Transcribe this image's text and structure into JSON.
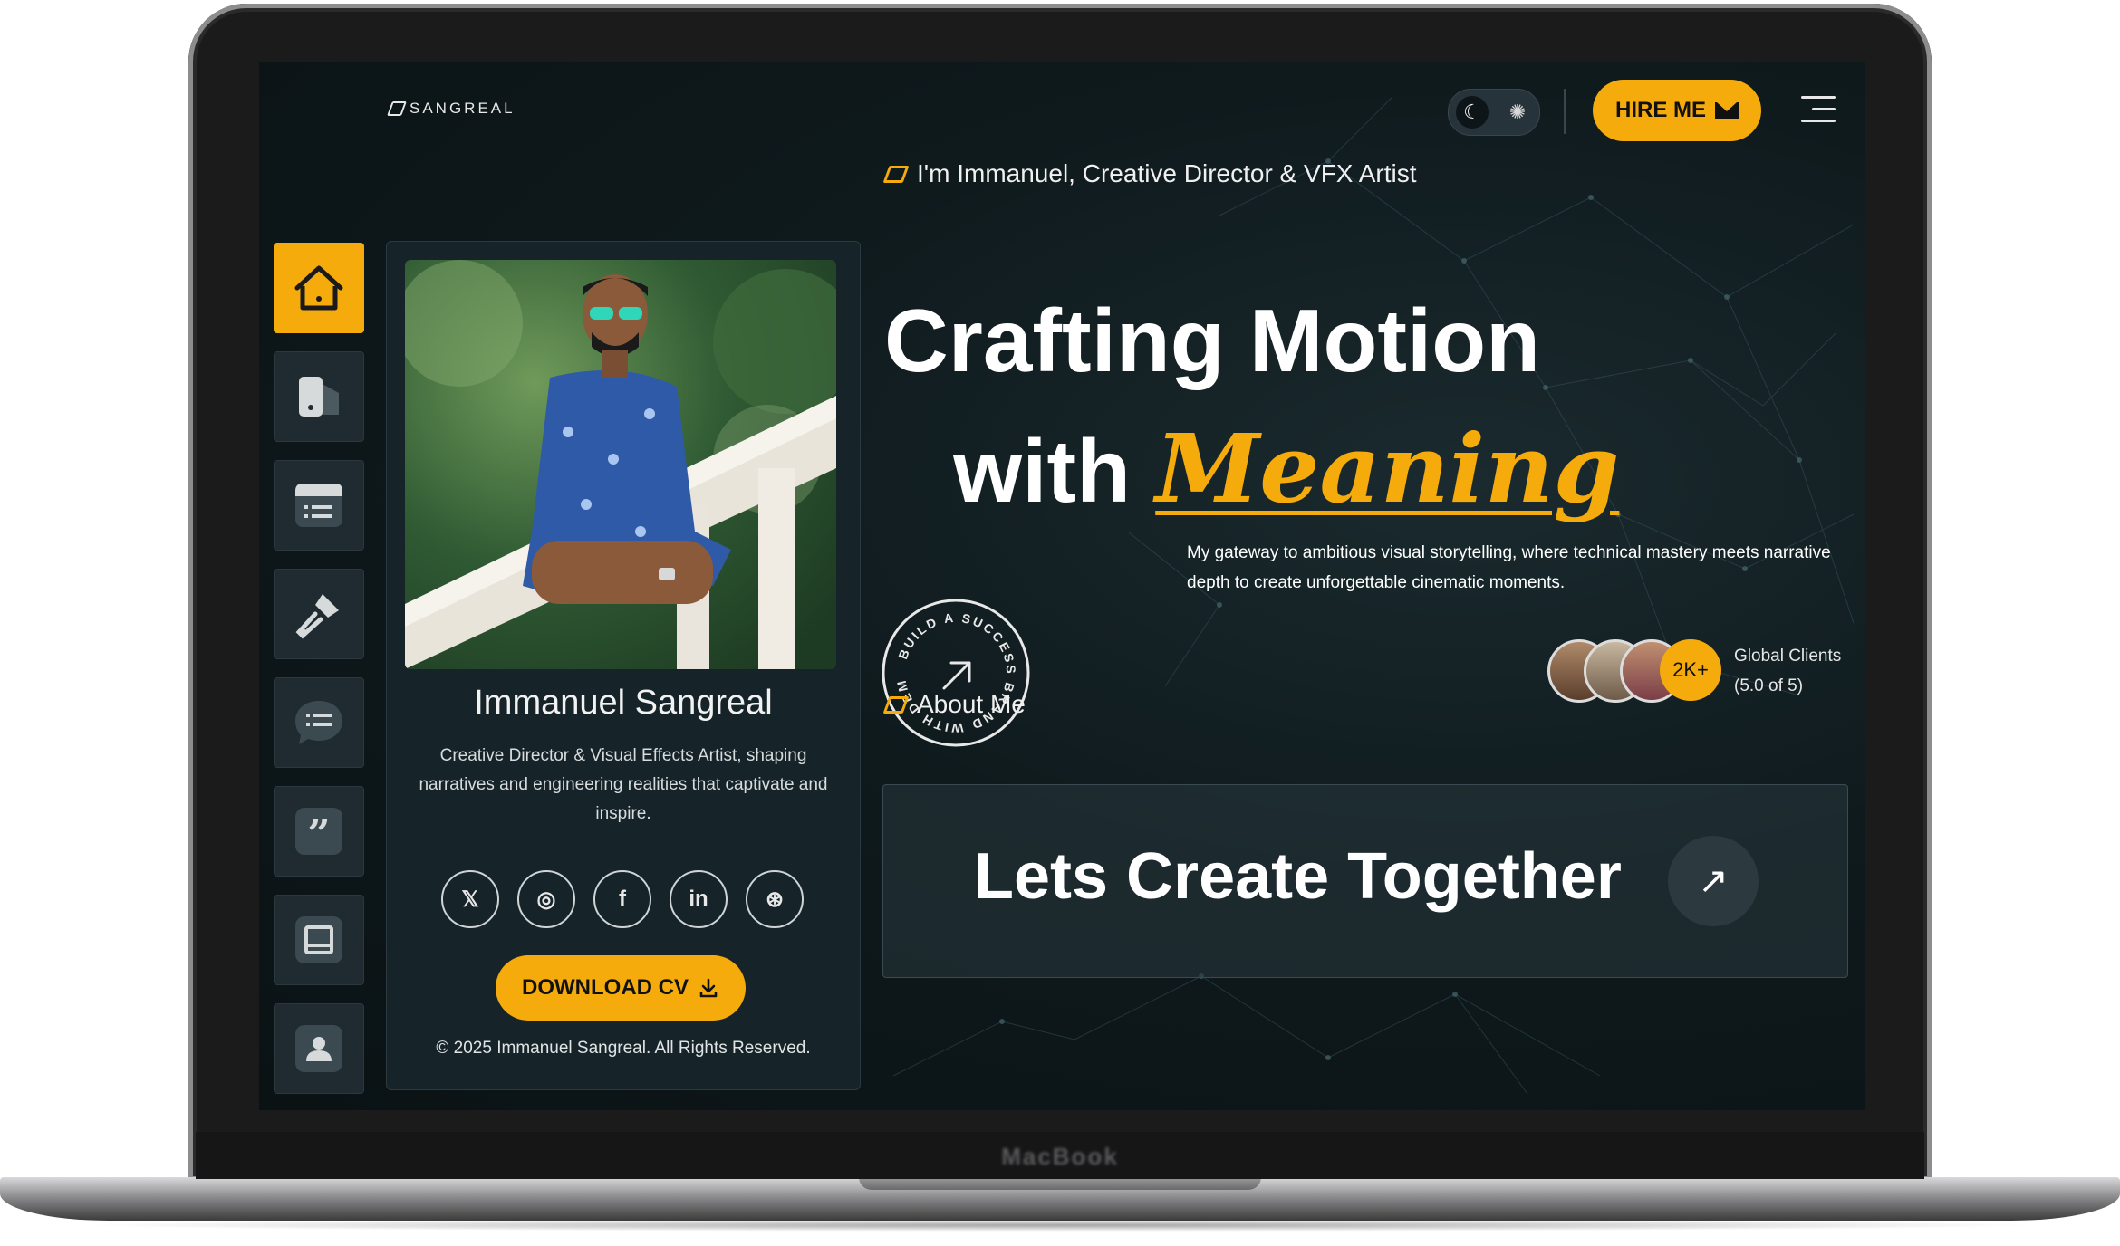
{
  "device": {
    "brand": "MacBook"
  },
  "header": {
    "logo": "SANGREAL",
    "theme_toggle": {
      "dark_icon": "moon-icon",
      "light_icon": "sun-icon",
      "mode": "dark"
    },
    "hire_label": "HIRE ME",
    "hire_icon": "envelope-icon",
    "menu_icon": "hamburger-menu-icon"
  },
  "sidebar": {
    "items": [
      {
        "icon": "home-icon",
        "active": true
      },
      {
        "icon": "portfolio-icon",
        "active": false
      },
      {
        "icon": "services-icon",
        "active": false
      },
      {
        "icon": "tools-icon",
        "active": false
      },
      {
        "icon": "chat-icon",
        "active": false
      },
      {
        "icon": "quote-icon",
        "active": false
      },
      {
        "icon": "blog-icon",
        "active": false
      },
      {
        "icon": "contact-icon",
        "active": false
      }
    ]
  },
  "profile": {
    "name": "Immanuel Sangreal",
    "bio": "Creative Director & Visual Effects Artist, shaping narratives and engineering realities that captivate and inspire.",
    "socials": [
      {
        "icon": "x-twitter-icon",
        "glyph": "𝕏"
      },
      {
        "icon": "instagram-icon",
        "glyph": "◎"
      },
      {
        "icon": "facebook-icon",
        "glyph": "f"
      },
      {
        "icon": "linkedin-icon",
        "glyph": "in"
      },
      {
        "icon": "dribbble-icon",
        "glyph": "⊛"
      }
    ],
    "download_label": "DOWNLOAD CV",
    "download_icon": "download-icon",
    "copyright": "© 2025 Immanuel Sangreal. All Rights Reserved."
  },
  "hero": {
    "tagline": "I'm Immanuel, Creative Director & VFX Artist",
    "title_line1": "Crafting Motion",
    "title_line2_prefix": "with ",
    "title_highlight": "Meaning",
    "lead": "My gateway to ambitious visual storytelling, where technical mastery meets narrative depth to create unforgettable cinematic moments.",
    "badge_text": "BUILD A SUCCESS BRAND WITH DEMOUI",
    "badge_icon": "arrow-up-right-icon",
    "clients_count": "2K+",
    "clients_label": "Global Clients",
    "clients_rating": "(5.0 of 5)",
    "cta_text": "Lets Create Together",
    "cta_icon": "arrow-up-right-icon",
    "section_label": "About Me"
  },
  "colors": {
    "accent": "#f6ab0c",
    "background": "#0f1a1d",
    "card": "#16242a"
  }
}
